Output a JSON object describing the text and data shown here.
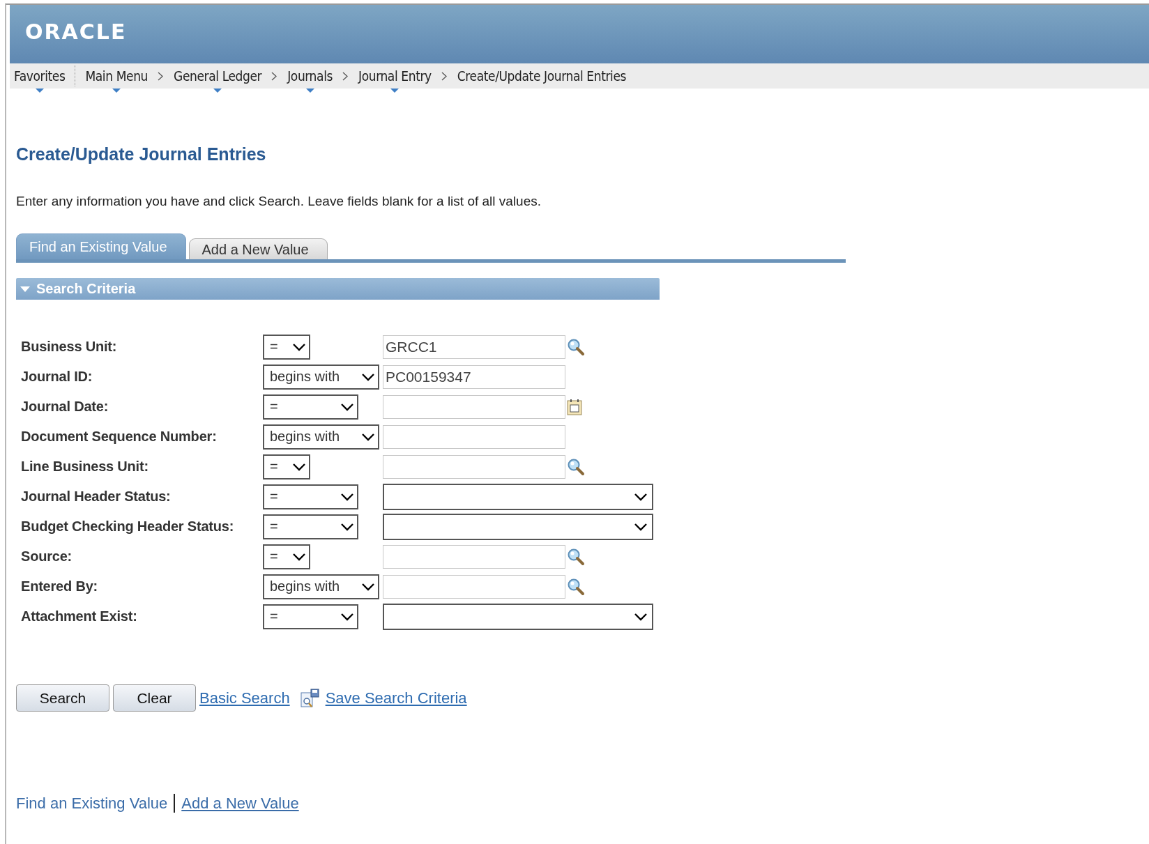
{
  "header": {
    "logo": "ORACLE"
  },
  "breadcrumbs": [
    {
      "label": "Favorites",
      "menu": true,
      "kind": "first"
    },
    {
      "label": "Main Menu",
      "menu": true,
      "kind": "divided"
    },
    {
      "label": "General Ledger",
      "menu": true,
      "kind": "chevron"
    },
    {
      "label": "Journals",
      "menu": true,
      "kind": "chevron"
    },
    {
      "label": "Journal Entry",
      "menu": true,
      "kind": "chevron"
    },
    {
      "label": "Create/Update Journal Entries",
      "menu": false,
      "kind": "chevron"
    }
  ],
  "page_title": "Create/Update Journal Entries",
  "instructions": "Enter any information you have and click Search. Leave fields blank for a list of all values.",
  "tabs": [
    {
      "label": "Find an Existing Value",
      "selected": true
    },
    {
      "label": "Add a New Value",
      "selected": false
    }
  ],
  "section": {
    "title": "Search Criteria",
    "expanded": true
  },
  "fields": [
    {
      "label": "Business Unit:",
      "operator": "=",
      "kind": "lookup",
      "value": "GRCC1"
    },
    {
      "label": "Journal ID:",
      "operator": "begins with",
      "kind": "text",
      "value": "PC00159347"
    },
    {
      "label": "Journal Date:",
      "operator": "=",
      "kind": "date"
    },
    {
      "label": "Document Sequence Number:",
      "operator": "begins with",
      "kind": "text"
    },
    {
      "label": "Line Business Unit:",
      "operator": "=",
      "kind": "lookup"
    },
    {
      "label": "Journal Header Status:",
      "operator": "=",
      "kind": "select"
    },
    {
      "label": "Budget Checking Header Status:",
      "operator": "=",
      "kind": "select"
    },
    {
      "label": "Source:",
      "operator": "=",
      "kind": "lookup"
    },
    {
      "label": "Entered By:",
      "operator": "begins with",
      "kind": "lookup"
    },
    {
      "label": "Attachment Exist:",
      "operator": "=",
      "kind": "select"
    }
  ],
  "buttons": [
    "Search",
    "Clear"
  ],
  "links": [
    {
      "label": "Basic Search",
      "icon": false
    },
    {
      "label": "Save Search Criteria",
      "icon": true
    }
  ],
  "footer_links": [
    {
      "label": "Find an Existing Value",
      "selected": true
    },
    {
      "label": "Add a New Value",
      "selected": false
    }
  ]
}
